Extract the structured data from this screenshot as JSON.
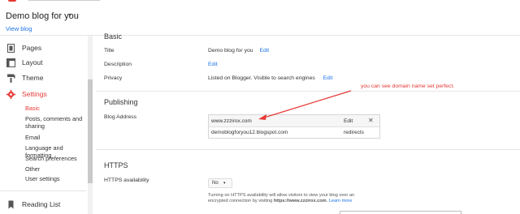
{
  "header": {
    "blog_title": "Demo blog for you",
    "caret": "▾",
    "view_blog": "View blog"
  },
  "sidebar": {
    "items": [
      {
        "name": "pages",
        "label": "Pages",
        "icon": "pages-icon"
      },
      {
        "name": "layout",
        "label": "Layout",
        "icon": "layout-icon"
      },
      {
        "name": "theme",
        "label": "Theme",
        "icon": "theme-icon"
      },
      {
        "name": "settings",
        "label": "Settings",
        "icon": "gear-icon"
      }
    ],
    "sub_items": [
      "Basic",
      "Posts, comments and sharing",
      "Email",
      "Language and formatting",
      "Search preferences",
      "Other",
      "User settings"
    ],
    "reading_list": "Reading List"
  },
  "basic": {
    "heading": "Basic",
    "title_label": "Title",
    "title_value": "Demo blog for you",
    "description_label": "Description",
    "privacy_label": "Privacy",
    "privacy_value": "Listed on Blogger. Visible to search engines",
    "edit": "Edit"
  },
  "publishing": {
    "heading": "Publishing",
    "blog_address_label": "Blog Address",
    "custom_domain": "www.zzzirox.com",
    "edit": "Edit",
    "close": "✕",
    "blogspot_address": "demoblogforyou12.blogspot.com",
    "redirects": "redirects"
  },
  "https": {
    "heading": "HTTPS",
    "availability_label": "HTTPS availability",
    "select_value": "No",
    "select_caret": "▾",
    "note_1": "Turning on HTTPS availability will allow visitors to view your blog over an",
    "note_2_prefix": "encrypted connection by visiting ",
    "note_2_url": "https://www.zzzirox.com",
    "note_2_suffix": ". ",
    "note_2_link": "Learn more"
  },
  "annotation": {
    "text": "you can see domain name set perfect.",
    "color": "#e53935"
  },
  "colors": {
    "accent": "#e53935",
    "link": "#1a73e8"
  }
}
